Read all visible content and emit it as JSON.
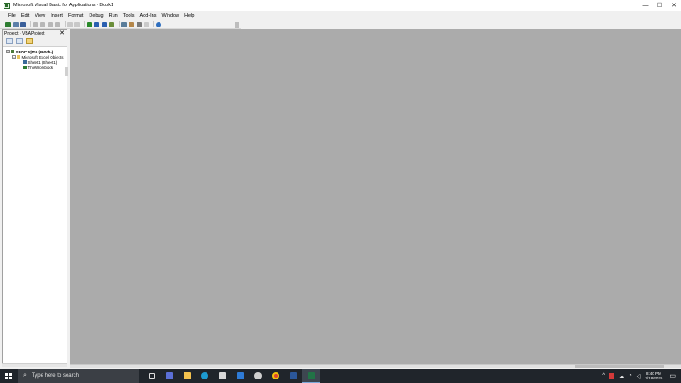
{
  "window": {
    "title": "Microsoft Visual Basic for Applications - Book1",
    "controls": {
      "minimize": "—",
      "maximize": "☐",
      "close": "✕"
    }
  },
  "menu": [
    "File",
    "Edit",
    "View",
    "Insert",
    "Format",
    "Debug",
    "Run",
    "Tools",
    "Add-Ins",
    "Window",
    "Help"
  ],
  "project_pane": {
    "title": "Project - VBAProject",
    "close": "✕",
    "tree": {
      "root": "VBAProject (Book1)",
      "folder": "Microsoft Excel Objects",
      "items": [
        "Sheet1 (Sheet1)",
        "ThisWorkbook"
      ]
    }
  },
  "taskbar": {
    "search_placeholder": "Type here to search",
    "time": "8:40 PM",
    "date": "3/18/2026"
  },
  "colors": {
    "code_area": "#ababab",
    "taskbar": "#20252b",
    "excel_green": "#217346",
    "word_blue": "#2b579a"
  }
}
